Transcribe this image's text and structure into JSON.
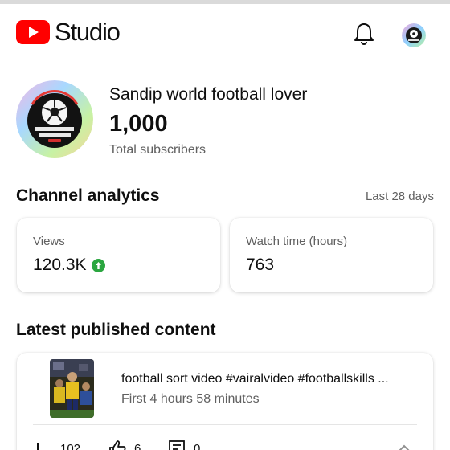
{
  "app": {
    "logo_text": "Studio"
  },
  "header": {
    "notifications_icon": "bell-icon",
    "account_icon": "avatar"
  },
  "channel": {
    "name": "Sandip world football lover",
    "subscriber_count": "1,000",
    "subscriber_label": "Total subscribers",
    "avatar_text": "SANDIP WORLD FOOTBALL LOVER"
  },
  "analytics": {
    "title": "Channel analytics",
    "period": "Last 28 days",
    "views_label": "Views",
    "views_value": "120.3K",
    "views_trend_icon": "arrow-up-circle-icon",
    "watch_label": "Watch time (hours)",
    "watch_value": "763"
  },
  "latest": {
    "title": "Latest published content",
    "video_title": "football sort video #vairalvideo #footballskills ...",
    "video_age": "First 4 hours 58 minutes",
    "views": "102",
    "likes": "6",
    "comments": "0"
  },
  "colors": {
    "brand_red": "#ff0000",
    "trend_green": "#2ba640",
    "muted_text": "#606060"
  }
}
